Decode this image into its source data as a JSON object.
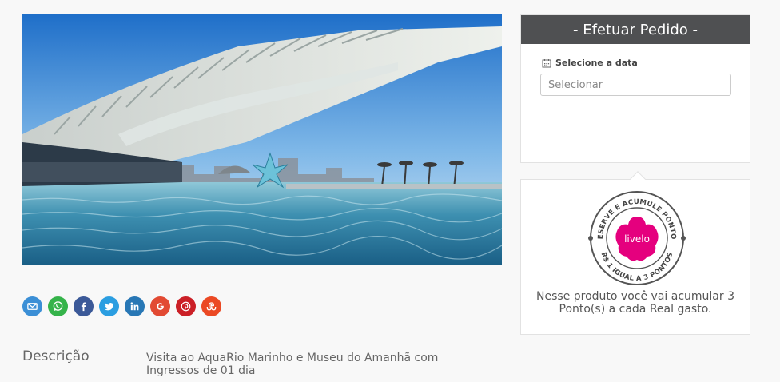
{
  "hero": {
    "alt": "Museu do Amanhã"
  },
  "share": {
    "buttons": [
      {
        "name": "email-icon",
        "color": "#3b8fd6"
      },
      {
        "name": "whatsapp-icon",
        "color": "#35b34a"
      },
      {
        "name": "facebook-icon",
        "color": "#3b5998"
      },
      {
        "name": "twitter-icon",
        "color": "#2b9ee1"
      },
      {
        "name": "linkedin-icon",
        "color": "#2877b5"
      },
      {
        "name": "google-icon",
        "color": "#e24a33"
      },
      {
        "name": "pinterest-icon",
        "color": "#cb2027"
      },
      {
        "name": "stumbleupon-icon",
        "color": "#eb4924"
      }
    ]
  },
  "description": {
    "label": "Descrição",
    "text": "Visita ao AquaRio Marinho e Museu do Amanhã com Ingressos de 01 dia"
  },
  "order": {
    "title": "- Efetuar Pedido -",
    "date_label": "Selecione a data",
    "date_placeholder": "Selecionar"
  },
  "points": {
    "badge": {
      "top_text": "RESERVE E ACUMULE PONTOS",
      "bottom_text": "R$ 1 IGUAL A 3 PONTOS",
      "brand": "livelo",
      "brand_color": "#e5007e"
    },
    "text": "Nesse produto você vai acumular 3 Ponto(s) a cada Real gasto."
  }
}
